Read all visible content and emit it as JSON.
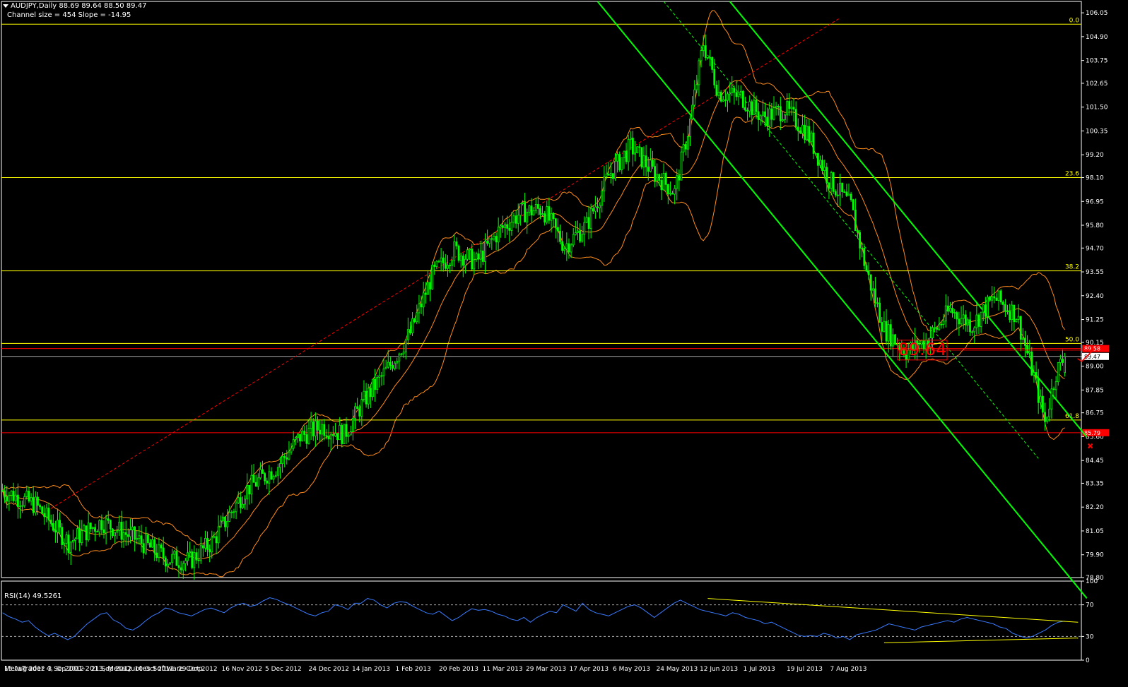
{
  "header": {
    "symbol_line": "AUDJPY,Daily  88.69 89.64 88.50 89.47",
    "channel_line": "Channel size = 454 Slope = -14.95"
  },
  "rsi_label": "RSI(14) 49.5261",
  "copyright": "MetaTrader 4, © 2001-2013, MetaQuotes Software Corp.",
  "colors": {
    "background": "#000000",
    "grid_frame": "#ffffff",
    "candles": "#00ff00",
    "bollinger": "#ff8c1a",
    "fib_lines": "#ffff00",
    "channel": "#00ff00",
    "resistance": "#ff0000",
    "rsi_line": "#3a7bff",
    "annotation": "#ff0000"
  },
  "icons": {
    "menu": "triangle-down-icon",
    "cross": "x-mark-icon",
    "check": "check-mark-icon"
  },
  "chart_data": [
    {
      "type": "candlestick",
      "title": "AUDJPY,Daily",
      "ylim": [
        78.8,
        106.6
      ],
      "y_ticks": [
        "106.05",
        "104.90",
        "103.75",
        "102.65",
        "101.50",
        "100.35",
        "99.20",
        "98.10",
        "96.95",
        "95.80",
        "94.70",
        "93.55",
        "92.40",
        "91.25",
        "90.15",
        "89.47",
        "89.00",
        "87.85",
        "86.75",
        "85.60",
        "84.45",
        "83.35",
        "82.20",
        "81.05",
        "79.90",
        "78.80"
      ],
      "x_ticks": [
        "15 Aug 2012",
        "3 Sep 2012",
        "21 Sep 2012",
        "10 Oct 2012",
        "29 Oct 2012",
        "16 Nov 2012",
        "5 Dec 2012",
        "24 Dec 2012",
        "14 Jan 2013",
        "1 Feb 2013",
        "20 Feb 2013",
        "11 Mar 2013",
        "29 Mar 2013",
        "17 Apr 2013",
        "6 May 2013",
        "24 May 2013",
        "12 Jun 2013",
        "1 Jul 2013",
        "19 Jul 2013",
        "7 Aug 2013"
      ],
      "price_path": [
        [
          0,
          83.0
        ],
        [
          15,
          82.3
        ],
        [
          30,
          80.5
        ],
        [
          45,
          81.5
        ],
        [
          60,
          80.7
        ],
        [
          75,
          79.7
        ],
        [
          85,
          79.6
        ],
        [
          95,
          80.5
        ],
        [
          110,
          83.0
        ],
        [
          125,
          84.2
        ],
        [
          135,
          85.6
        ],
        [
          145,
          86.1
        ],
        [
          155,
          85.7
        ],
        [
          165,
          87.5
        ],
        [
          175,
          88.9
        ],
        [
          185,
          90.6
        ],
        [
          195,
          93.4
        ],
        [
          205,
          94.6
        ],
        [
          215,
          94.0
        ],
        [
          225,
          95.5
        ],
        [
          235,
          96.4
        ],
        [
          245,
          96.6
        ],
        [
          255,
          94.8
        ],
        [
          265,
          95.8
        ],
        [
          275,
          98.2
        ],
        [
          285,
          99.6
        ],
        [
          295,
          98.4
        ],
        [
          305,
          97.4
        ],
        [
          312,
          100.8
        ],
        [
          318,
          104.6
        ],
        [
          325,
          102.2
        ],
        [
          335,
          102.0
        ],
        [
          345,
          101.0
        ],
        [
          355,
          101.4
        ],
        [
          365,
          100.3
        ],
        [
          375,
          98.0
        ],
        [
          385,
          96.7
        ],
        [
          392,
          93.6
        ],
        [
          400,
          90.8
        ],
        [
          410,
          89.7
        ],
        [
          420,
          90.3
        ],
        [
          430,
          91.7
        ],
        [
          440,
          91.0
        ],
        [
          450,
          92.3
        ],
        [
          460,
          91.5
        ],
        [
          468,
          88.5
        ],
        [
          473,
          86.3
        ],
        [
          478,
          88.7
        ],
        [
          482,
          89.47
        ]
      ],
      "last": {
        "open": 88.69,
        "high": 89.64,
        "low": 88.5,
        "close": 89.47
      },
      "fibonacci_levels": [
        {
          "label": "0.0",
          "price": 105.5
        },
        {
          "label": "23.6",
          "price": 98.1
        },
        {
          "label": "38.2",
          "price": 93.6
        },
        {
          "label": "50.0",
          "price": 90.1
        },
        {
          "label": "61.8",
          "price": 86.4
        }
      ],
      "horizontal_red_lines": [
        {
          "price": 89.85,
          "label": "89.58"
        },
        {
          "price": 85.79,
          "label": "85.79"
        }
      ],
      "current_price_label": "89.47",
      "annotation_text": "89.64",
      "channel": {
        "size": 454,
        "slope": -14.95
      }
    },
    {
      "type": "line",
      "title": "RSI(14) 49.5261",
      "ylim": [
        0,
        100
      ],
      "y_ticks": [
        "100",
        "70",
        "30",
        "0"
      ],
      "levels": [
        70,
        30
      ],
      "last_value": 49.5261,
      "values": [
        60,
        55,
        52,
        48,
        50,
        42,
        36,
        31,
        34,
        30,
        26,
        30,
        38,
        46,
        52,
        58,
        60,
        51,
        47,
        40,
        38,
        43,
        50,
        56,
        60,
        66,
        64,
        60,
        58,
        56,
        60,
        64,
        66,
        63,
        60,
        66,
        70,
        72,
        68,
        70,
        75,
        79,
        77,
        73,
        70,
        66,
        62,
        58,
        56,
        60,
        62,
        70,
        68,
        64,
        72,
        72,
        78,
        76,
        70,
        66,
        72,
        74,
        73,
        68,
        64,
        60,
        58,
        62,
        56,
        50,
        54,
        60,
        65,
        63,
        64,
        62,
        58,
        56,
        52,
        50,
        54,
        48,
        54,
        58,
        62,
        60,
        70,
        66,
        62,
        72,
        64,
        60,
        58,
        56,
        60,
        64,
        68,
        70,
        66,
        60,
        54,
        60,
        66,
        72,
        76,
        72,
        68,
        64,
        62,
        60,
        58,
        56,
        60,
        58,
        54,
        52,
        50,
        46,
        48,
        44,
        40,
        36,
        32,
        30,
        31,
        30,
        34,
        32,
        28,
        30,
        26,
        32,
        34,
        36,
        38,
        42,
        46,
        44,
        42,
        40,
        38,
        42,
        44,
        46,
        48,
        50,
        48,
        52,
        54,
        52,
        50,
        48,
        46,
        42,
        40,
        34,
        31,
        28,
        30,
        34,
        38,
        44,
        48,
        49.5
      ]
    }
  ]
}
